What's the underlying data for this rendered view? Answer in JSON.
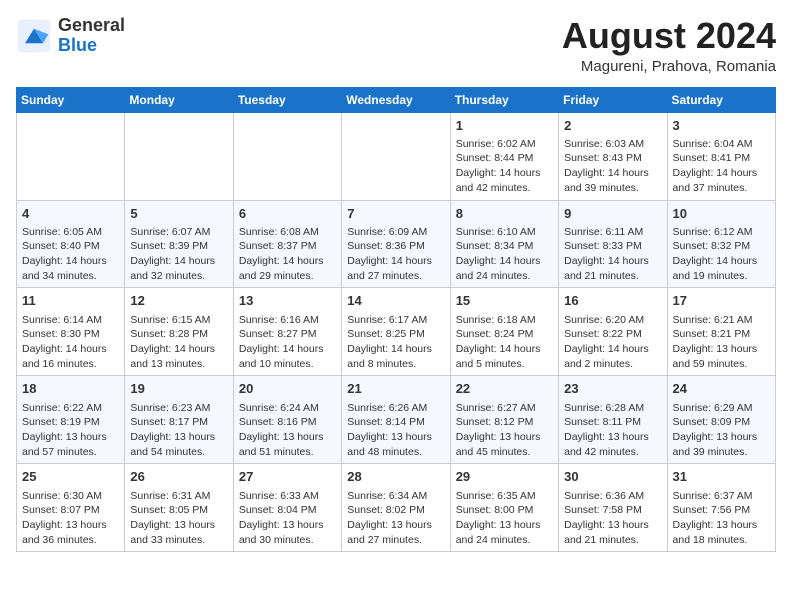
{
  "header": {
    "logo_line1": "General",
    "logo_line2": "Blue",
    "month_title": "August 2024",
    "location": "Magureni, Prahova, Romania"
  },
  "weekdays": [
    "Sunday",
    "Monday",
    "Tuesday",
    "Wednesday",
    "Thursday",
    "Friday",
    "Saturday"
  ],
  "weeks": [
    [
      {
        "day": "",
        "info": ""
      },
      {
        "day": "",
        "info": ""
      },
      {
        "day": "",
        "info": ""
      },
      {
        "day": "",
        "info": ""
      },
      {
        "day": "1",
        "info": "Sunrise: 6:02 AM\nSunset: 8:44 PM\nDaylight: 14 hours\nand 42 minutes."
      },
      {
        "day": "2",
        "info": "Sunrise: 6:03 AM\nSunset: 8:43 PM\nDaylight: 14 hours\nand 39 minutes."
      },
      {
        "day": "3",
        "info": "Sunrise: 6:04 AM\nSunset: 8:41 PM\nDaylight: 14 hours\nand 37 minutes."
      }
    ],
    [
      {
        "day": "4",
        "info": "Sunrise: 6:05 AM\nSunset: 8:40 PM\nDaylight: 14 hours\nand 34 minutes."
      },
      {
        "day": "5",
        "info": "Sunrise: 6:07 AM\nSunset: 8:39 PM\nDaylight: 14 hours\nand 32 minutes."
      },
      {
        "day": "6",
        "info": "Sunrise: 6:08 AM\nSunset: 8:37 PM\nDaylight: 14 hours\nand 29 minutes."
      },
      {
        "day": "7",
        "info": "Sunrise: 6:09 AM\nSunset: 8:36 PM\nDaylight: 14 hours\nand 27 minutes."
      },
      {
        "day": "8",
        "info": "Sunrise: 6:10 AM\nSunset: 8:34 PM\nDaylight: 14 hours\nand 24 minutes."
      },
      {
        "day": "9",
        "info": "Sunrise: 6:11 AM\nSunset: 8:33 PM\nDaylight: 14 hours\nand 21 minutes."
      },
      {
        "day": "10",
        "info": "Sunrise: 6:12 AM\nSunset: 8:32 PM\nDaylight: 14 hours\nand 19 minutes."
      }
    ],
    [
      {
        "day": "11",
        "info": "Sunrise: 6:14 AM\nSunset: 8:30 PM\nDaylight: 14 hours\nand 16 minutes."
      },
      {
        "day": "12",
        "info": "Sunrise: 6:15 AM\nSunset: 8:28 PM\nDaylight: 14 hours\nand 13 minutes."
      },
      {
        "day": "13",
        "info": "Sunrise: 6:16 AM\nSunset: 8:27 PM\nDaylight: 14 hours\nand 10 minutes."
      },
      {
        "day": "14",
        "info": "Sunrise: 6:17 AM\nSunset: 8:25 PM\nDaylight: 14 hours\nand 8 minutes."
      },
      {
        "day": "15",
        "info": "Sunrise: 6:18 AM\nSunset: 8:24 PM\nDaylight: 14 hours\nand 5 minutes."
      },
      {
        "day": "16",
        "info": "Sunrise: 6:20 AM\nSunset: 8:22 PM\nDaylight: 14 hours\nand 2 minutes."
      },
      {
        "day": "17",
        "info": "Sunrise: 6:21 AM\nSunset: 8:21 PM\nDaylight: 13 hours\nand 59 minutes."
      }
    ],
    [
      {
        "day": "18",
        "info": "Sunrise: 6:22 AM\nSunset: 8:19 PM\nDaylight: 13 hours\nand 57 minutes."
      },
      {
        "day": "19",
        "info": "Sunrise: 6:23 AM\nSunset: 8:17 PM\nDaylight: 13 hours\nand 54 minutes."
      },
      {
        "day": "20",
        "info": "Sunrise: 6:24 AM\nSunset: 8:16 PM\nDaylight: 13 hours\nand 51 minutes."
      },
      {
        "day": "21",
        "info": "Sunrise: 6:26 AM\nSunset: 8:14 PM\nDaylight: 13 hours\nand 48 minutes."
      },
      {
        "day": "22",
        "info": "Sunrise: 6:27 AM\nSunset: 8:12 PM\nDaylight: 13 hours\nand 45 minutes."
      },
      {
        "day": "23",
        "info": "Sunrise: 6:28 AM\nSunset: 8:11 PM\nDaylight: 13 hours\nand 42 minutes."
      },
      {
        "day": "24",
        "info": "Sunrise: 6:29 AM\nSunset: 8:09 PM\nDaylight: 13 hours\nand 39 minutes."
      }
    ],
    [
      {
        "day": "25",
        "info": "Sunrise: 6:30 AM\nSunset: 8:07 PM\nDaylight: 13 hours\nand 36 minutes."
      },
      {
        "day": "26",
        "info": "Sunrise: 6:31 AM\nSunset: 8:05 PM\nDaylight: 13 hours\nand 33 minutes."
      },
      {
        "day": "27",
        "info": "Sunrise: 6:33 AM\nSunset: 8:04 PM\nDaylight: 13 hours\nand 30 minutes."
      },
      {
        "day": "28",
        "info": "Sunrise: 6:34 AM\nSunset: 8:02 PM\nDaylight: 13 hours\nand 27 minutes."
      },
      {
        "day": "29",
        "info": "Sunrise: 6:35 AM\nSunset: 8:00 PM\nDaylight: 13 hours\nand 24 minutes."
      },
      {
        "day": "30",
        "info": "Sunrise: 6:36 AM\nSunset: 7:58 PM\nDaylight: 13 hours\nand 21 minutes."
      },
      {
        "day": "31",
        "info": "Sunrise: 6:37 AM\nSunset: 7:56 PM\nDaylight: 13 hours\nand 18 minutes."
      }
    ]
  ]
}
